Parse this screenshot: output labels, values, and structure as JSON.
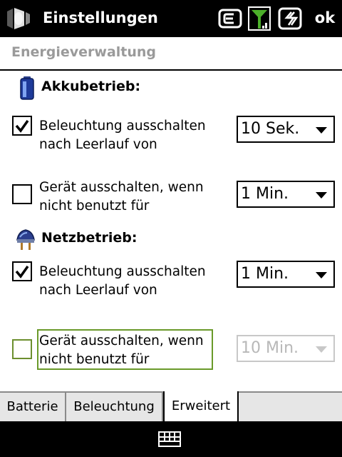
{
  "titlebar": {
    "title": "Einstellungen",
    "ok_label": "ok",
    "icons": [
      "start-icon",
      "connectivity-icon",
      "signal-icon",
      "data-connection-icon"
    ]
  },
  "page": {
    "title": "Energieverwaltung"
  },
  "battery": {
    "heading": "Akkubetrieb:",
    "icon": "battery-icon",
    "backlight": {
      "checked": true,
      "label_line1": "Beleuchtung ausschalten",
      "label_line2": "nach Leerlauf von",
      "value": "10 Sek."
    },
    "device_off": {
      "checked": false,
      "label_line1": "Gerät ausschalten, wenn",
      "label_line2": "nicht benutzt für",
      "value": "1 Min."
    }
  },
  "external": {
    "heading": "Netzbetrieb:",
    "icon": "power-plug-icon",
    "backlight": {
      "checked": true,
      "label_line1": "Beleuchtung ausschalten",
      "label_line2": "nach Leerlauf von",
      "value": "1 Min."
    },
    "device_off": {
      "checked": false,
      "label_line1": "Gerät ausschalten, wenn",
      "label_line2": "nicht benutzt für",
      "value": "10 Min.",
      "enabled": false
    }
  },
  "tabs": [
    {
      "label": "Batterie",
      "active": false
    },
    {
      "label": "Beleuchtung",
      "active": false
    },
    {
      "label": "Erweitert",
      "active": true
    }
  ],
  "softbar": {
    "icon": "keyboard-icon"
  },
  "colors": {
    "bar_bg": "#000000",
    "page_title": "#9a9a9a",
    "focus": "#6a9a2a",
    "disabled": "#b8b8b8"
  }
}
